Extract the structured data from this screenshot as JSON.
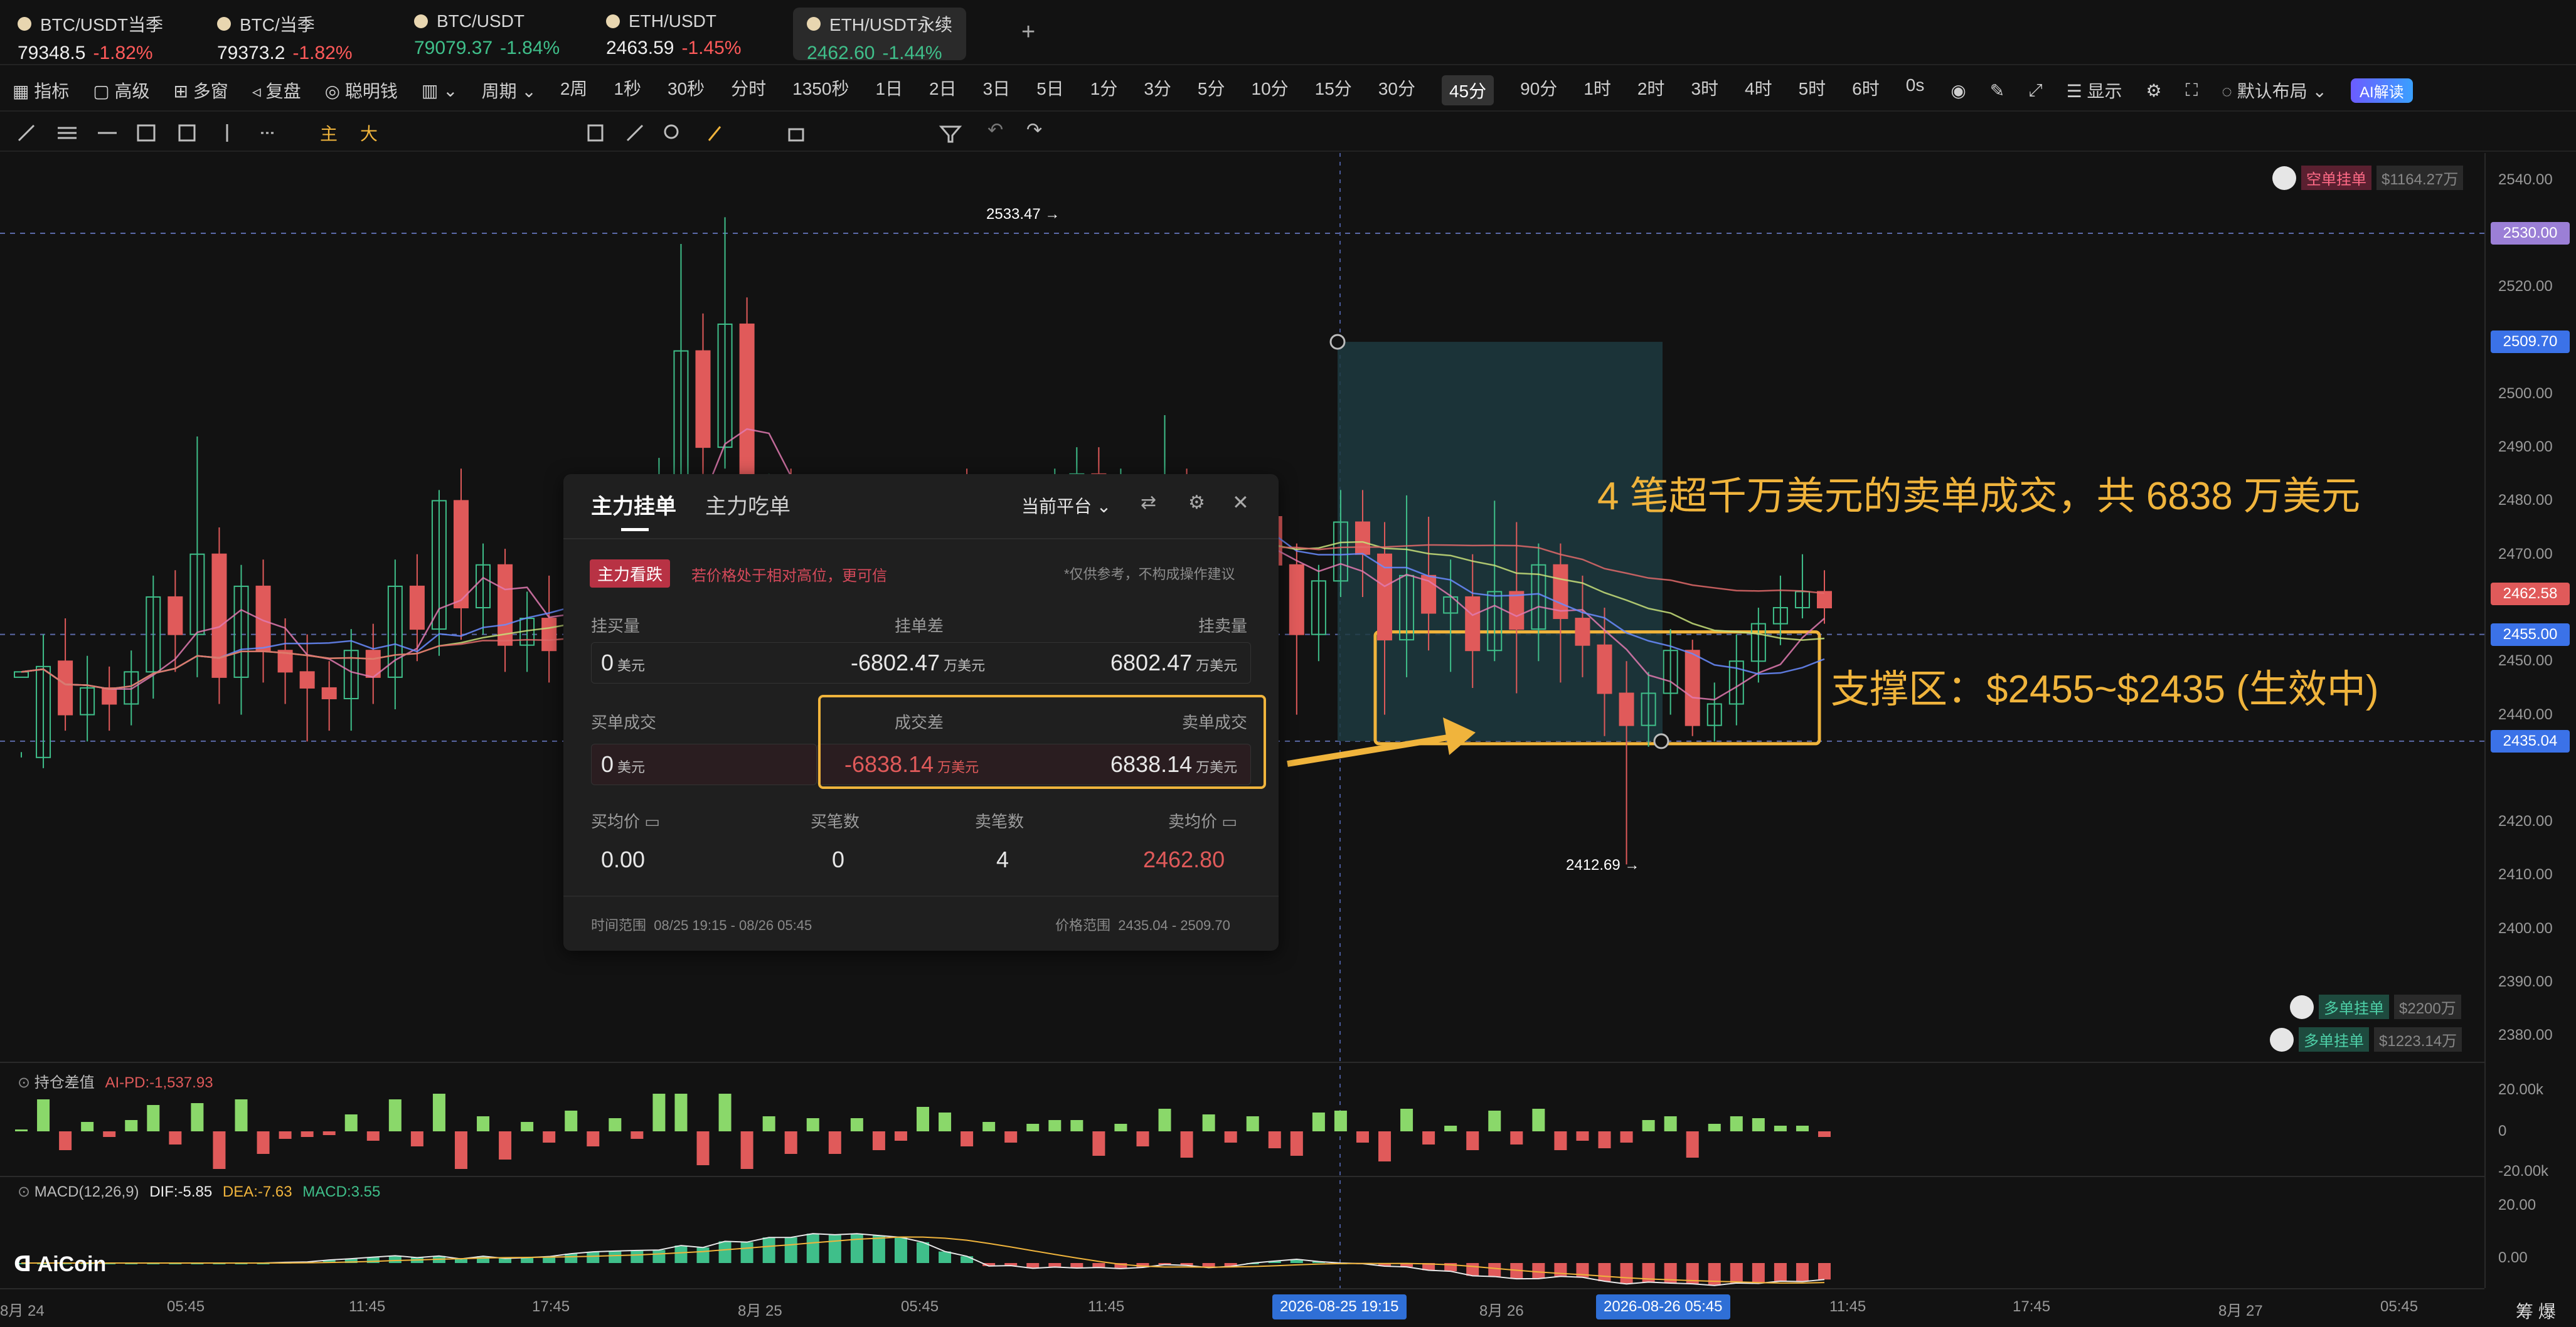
{
  "tickers": [
    {
      "name": "BTC/USDT当季",
      "price": "79348.5",
      "change": "-1.82%",
      "color": "#ff5a5a"
    },
    {
      "name": "BTC/当季",
      "price": "79373.2",
      "change": "-1.82%",
      "color": "#ff5a5a"
    },
    {
      "name": "BTC/USDT",
      "price": "79079.37",
      "change": "-1.84%",
      "color": "#3fbf8a"
    },
    {
      "name": "ETH/USDT",
      "price": "2463.59",
      "change": "-1.45%",
      "color": "#ff5a5a"
    },
    {
      "name": "ETH/USDT永续",
      "price": "2462.60",
      "change": "-1.44%",
      "color": "#3fbf8a"
    }
  ],
  "add_tab": "+",
  "toolbar1": {
    "left": [
      "指标",
      "高级",
      "多窗",
      "复盘",
      "聪明钱",
      "周期"
    ],
    "intervals": [
      "2周",
      "1秒",
      "30秒",
      "分时",
      "1350秒",
      "1日",
      "2日",
      "3日",
      "5日",
      "1分",
      "3分",
      "5分",
      "10分",
      "15分",
      "30分",
      "45分",
      "90分",
      "1时",
      "2时",
      "3时",
      "4时",
      "5时",
      "6时",
      "0s"
    ],
    "active_interval": "45分",
    "show": "显示",
    "layout": "默认布局",
    "ai": "AI解读"
  },
  "toolbar2_text": [
    "主",
    "大"
  ],
  "panel": {
    "tabs": [
      "主力挂单",
      "主力吃单"
    ],
    "platform": "当前平台",
    "badge": "主力看跌",
    "hint": "若价格处于相对高位，更可信",
    "disclaimer": "*仅供参考，不构成操作建议",
    "row1_labels": [
      "挂买量",
      "挂单差",
      "挂卖量"
    ],
    "row1_values": {
      "buy": "0",
      "diff": "-6802.47",
      "sell": "6802.47"
    },
    "row2_labels": [
      "买单成交",
      "成交差",
      "卖单成交"
    ],
    "row2_values": {
      "buy": "0",
      "diff": "-6838.14",
      "sell": "6838.14"
    },
    "unit_usd": "美元",
    "unit_wan": "万美元",
    "row3_labels": [
      "买均价",
      "买笔数",
      "卖笔数",
      "卖均价"
    ],
    "row3_values": [
      "0.00",
      "0",
      "4",
      "2462.80"
    ],
    "time_range_label": "时间范围",
    "time_range": "08/25 19:15 - 08/26 05:45",
    "price_range_label": "价格范围",
    "price_range": "2435.04 - 2509.70"
  },
  "annotations": {
    "sell": "4 笔超千万美元的卖单成交，共 6838 万美元",
    "support": "支撑区：$2455~$2435 (生效中)"
  },
  "price_marks": {
    "high": "2533.47",
    "low": "2412.69"
  },
  "order_tags": [
    {
      "label": "空单挂单",
      "amount": "$1164.27万",
      "color": "#d43b5d"
    },
    {
      "label": "多单挂单",
      "amount": "$2200万",
      "color": "#2aa585"
    },
    {
      "label": "多单挂单",
      "amount": "$1223.14万",
      "color": "#2aa585"
    }
  ],
  "price_axis": {
    "ticks": [
      "2540.00",
      "2520.00",
      "2500.00",
      "2490.00",
      "2480.00",
      "2470.00",
      "2450.00",
      "2440.00",
      "2420.00",
      "2410.00",
      "2400.00",
      "2390.00",
      "2380.00"
    ],
    "tags": [
      {
        "v": "2530.00",
        "color": "#9b7fd6"
      },
      {
        "v": "2509.70",
        "color": "#3b72e8"
      },
      {
        "v": "2462.58",
        "color": "#e05a5a"
      },
      {
        "v": "2455.00",
        "color": "#3b72e8"
      },
      {
        "v": "2435.04",
        "color": "#3b72e8"
      }
    ],
    "ind1": [
      "20.00k",
      "0",
      "-20.00k"
    ],
    "ind2": [
      "20.00",
      "0.00"
    ]
  },
  "time_axis": {
    "ticks": [
      "8月 24",
      "05:45",
      "11:45",
      "17:45",
      "8月 25",
      "05:45",
      "11:45",
      "8月 26",
      "11:45",
      "17:45",
      "8月 27",
      "05:45"
    ],
    "tags": [
      "2026-08-25 19:15",
      "2026-08-26 05:45"
    ],
    "right": [
      "筹",
      "爆"
    ]
  },
  "indicators": {
    "oi": {
      "name": "持仓差值",
      "value": "AI-PD:-1,537.93"
    },
    "macd": {
      "name": "MACD(12,26,9)",
      "dif": "DIF:-5.85",
      "dea": "DEA:-7.63",
      "macd": "MACD:3.55"
    }
  },
  "logo": "AiCoin",
  "chart_data": {
    "type": "candlestick",
    "ylim": [
      2375,
      2545
    ],
    "candles": [
      [
        2447,
        2448,
        2433,
        2432
      ],
      [
        2432,
        2449,
        2455,
        2430
      ],
      [
        2450,
        2440,
        2458,
        2437
      ],
      [
        2440,
        2445,
        2451,
        2435
      ],
      [
        2445,
        2442,
        2449,
        2437
      ],
      [
        2442,
        2448,
        2452,
        2438
      ],
      [
        2448,
        2462,
        2466,
        2443
      ],
      [
        2462,
        2455,
        2467,
        2448
      ],
      [
        2455,
        2470,
        2492,
        2447
      ],
      [
        2470,
        2447,
        2475,
        2442
      ],
      [
        2447,
        2464,
        2468,
        2440
      ],
      [
        2464,
        2452,
        2469,
        2446
      ],
      [
        2452,
        2448,
        2458,
        2442
      ],
      [
        2448,
        2445,
        2455,
        2435
      ],
      [
        2445,
        2443,
        2450,
        2437
      ],
      [
        2443,
        2452,
        2456,
        2437
      ],
      [
        2452,
        2447,
        2457,
        2442
      ],
      [
        2447,
        2464,
        2469,
        2441
      ],
      [
        2464,
        2456,
        2470,
        2450
      ],
      [
        2456,
        2480,
        2482,
        2451
      ],
      [
        2480,
        2460,
        2486,
        2454
      ],
      [
        2460,
        2468,
        2472,
        2455
      ],
      [
        2468,
        2453,
        2471,
        2448
      ],
      [
        2453,
        2458,
        2463,
        2448
      ],
      [
        2458,
        2452,
        2466,
        2446
      ],
      [
        2452,
        2463,
        2466,
        2448
      ],
      [
        2463,
        2455,
        2468,
        2450
      ],
      [
        2455,
        2462,
        2466,
        2452
      ],
      [
        2462,
        2458,
        2467,
        2449
      ],
      [
        2458,
        2484,
        2488,
        2455
      ],
      [
        2484,
        2508,
        2528,
        2480
      ],
      [
        2508,
        2490,
        2515,
        2485
      ],
      [
        2490,
        2513,
        2533,
        2486
      ],
      [
        2513,
        2472,
        2518,
        2465
      ],
      [
        2472,
        2480,
        2485,
        2465
      ],
      [
        2480,
        2468,
        2486,
        2460
      ],
      [
        2468,
        2475,
        2479,
        2463
      ],
      [
        2475,
        2463,
        2480,
        2458
      ],
      [
        2463,
        2470,
        2475,
        2457
      ],
      [
        2470,
        2460,
        2476,
        2454
      ],
      [
        2460,
        2455,
        2466,
        2450
      ],
      [
        2455,
        2468,
        2474,
        2452
      ],
      [
        2468,
        2478,
        2484,
        2463
      ],
      [
        2478,
        2470,
        2486,
        2465
      ],
      [
        2470,
        2475,
        2480,
        2466
      ],
      [
        2475,
        2469,
        2482,
        2464
      ],
      [
        2469,
        2473,
        2477,
        2463
      ],
      [
        2473,
        2479,
        2486,
        2470
      ],
      [
        2479,
        2485,
        2490,
        2474
      ],
      [
        2485,
        2472,
        2490,
        2466
      ],
      [
        2472,
        2476,
        2486,
        2468
      ],
      [
        2476,
        2468,
        2484,
        2462
      ],
      [
        2468,
        2480,
        2496,
        2465
      ],
      [
        2480,
        2466,
        2486,
        2458
      ],
      [
        2466,
        2475,
        2479,
        2460
      ],
      [
        2475,
        2469,
        2482,
        2463
      ],
      [
        2469,
        2477,
        2484,
        2465
      ],
      [
        2477,
        2468,
        2480,
        2460
      ],
      [
        2468,
        2455,
        2472,
        2440
      ],
      [
        2455,
        2465,
        2468,
        2450
      ],
      [
        2465,
        2476,
        2482,
        2462
      ],
      [
        2476,
        2470,
        2482,
        2462
      ],
      [
        2470,
        2454,
        2476,
        2440
      ],
      [
        2454,
        2466,
        2481,
        2447
      ],
      [
        2466,
        2459,
        2477,
        2452
      ],
      [
        2459,
        2462,
        2469,
        2448
      ],
      [
        2462,
        2452,
        2470,
        2445
      ],
      [
        2452,
        2463,
        2480,
        2450
      ],
      [
        2463,
        2456,
        2476,
        2444
      ],
      [
        2456,
        2468,
        2472,
        2450
      ],
      [
        2468,
        2458,
        2472,
        2446
      ],
      [
        2458,
        2453,
        2466,
        2447
      ],
      [
        2453,
        2444,
        2460,
        2436
      ],
      [
        2444,
        2438,
        2450,
        2412
      ],
      [
        2438,
        2444,
        2448,
        2434
      ],
      [
        2444,
        2452,
        2456,
        2440
      ],
      [
        2452,
        2438,
        2454,
        2436
      ],
      [
        2438,
        2442,
        2446,
        2435
      ],
      [
        2442,
        2450,
        2455,
        2438
      ],
      [
        2450,
        2457,
        2460,
        2446
      ],
      [
        2457,
        2460,
        2466,
        2453
      ],
      [
        2460,
        2463,
        2470,
        2458
      ],
      [
        2463,
        2460,
        2467,
        2457
      ]
    ]
  }
}
